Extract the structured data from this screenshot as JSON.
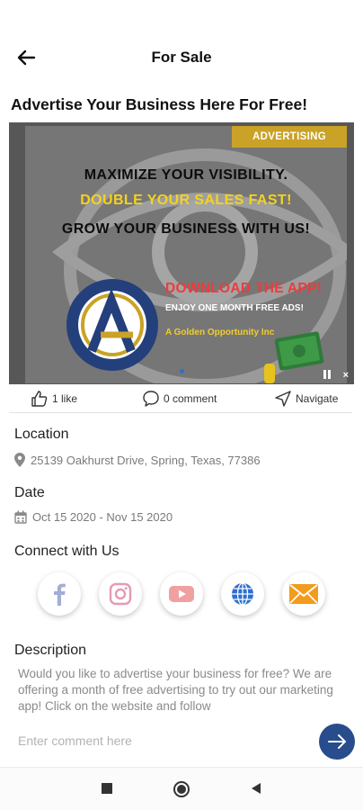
{
  "header": {
    "title": "For Sale",
    "back_icon": "arrow-left-icon"
  },
  "listing": {
    "title": "Advertise Your Business Here For Free!"
  },
  "ad": {
    "badge": "ADVERTISING",
    "line1": "MAXIMIZE YOUR VISIBILITY.",
    "line2": "DOUBLE YOUR SALES FAST!",
    "line3": "GROW YOUR BUSINESS WITH US!",
    "download": "DOWNLOAD THE APP!",
    "enjoy": "ENJOY ONE MONTH FREE ADS!",
    "golden": "A Golden Opportunity Inc",
    "close": "×",
    "colors": {
      "badge": "#c9a227",
      "yellow": "#f4d21f",
      "red": "#ef3b3b",
      "navy": "#23407c"
    }
  },
  "actions": {
    "like": "1 like",
    "comment": "0 comment",
    "navigate": "Navigate"
  },
  "location": {
    "label": "Location",
    "value": "25139 Oakhurst Drive, Spring, Texas, 77386"
  },
  "date": {
    "label": "Date",
    "value": "Oct 15 2020 - Nov 15 2020"
  },
  "connect": {
    "label": "Connect with Us",
    "items": [
      {
        "name": "facebook-icon",
        "color": "#a3aed6"
      },
      {
        "name": "instagram-icon",
        "color": "#e59ab5"
      },
      {
        "name": "youtube-icon",
        "color": "#f0a0a0"
      },
      {
        "name": "website-globe-icon",
        "color": "#2d6fd0"
      },
      {
        "name": "email-icon",
        "color": "#f39b1c"
      }
    ]
  },
  "description": {
    "label": "Description",
    "text": "Would you like to advertise your business for free? We are offering a month of free advertising to try out our marketing app! Click on the website and follow"
  },
  "comment": {
    "placeholder": "Enter comment here",
    "send_icon": "arrow-right-icon",
    "send_color": "#284c8c"
  },
  "system_nav": {
    "recent": "square-icon",
    "home": "circle-icon",
    "back": "triangle-back-icon"
  }
}
